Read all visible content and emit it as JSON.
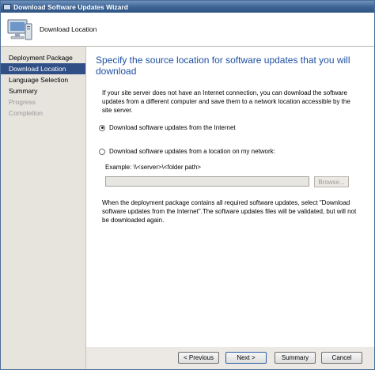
{
  "window": {
    "title": "Download Software Updates Wizard"
  },
  "header": {
    "title": "Download Location",
    "icon": "computer-icon"
  },
  "sidebar": {
    "items": [
      {
        "label": "Deployment Package",
        "state": "normal"
      },
      {
        "label": "Download Location",
        "state": "active"
      },
      {
        "label": "Language Selection",
        "state": "normal"
      },
      {
        "label": "Summary",
        "state": "normal"
      },
      {
        "label": "Progress",
        "state": "disabled"
      },
      {
        "label": "Completion",
        "state": "disabled"
      }
    ]
  },
  "main": {
    "heading": "Specify the source location for software updates that you will download",
    "description": "If your site server does not have an Internet connection, you can download the software updates from a different computer and save them to a network location accessible by the site server.",
    "option_internet": "Download software updates from the Internet",
    "option_network": "Download software updates from a location on my network:",
    "example": "Example: \\\\<server>\\<folder path>",
    "path_value": "",
    "browse_label": "Browse...",
    "note": "When the deployment package contains all required software updates, select \"Download  software updates from the Internet\".The software updates files will be validated, but will not be downloaded again."
  },
  "footer": {
    "previous": "< Previous",
    "next": "Next >",
    "summary": "Summary",
    "cancel": "Cancel"
  },
  "colors": {
    "heading": "#1e50a2",
    "active_item": "#2f4f86"
  }
}
